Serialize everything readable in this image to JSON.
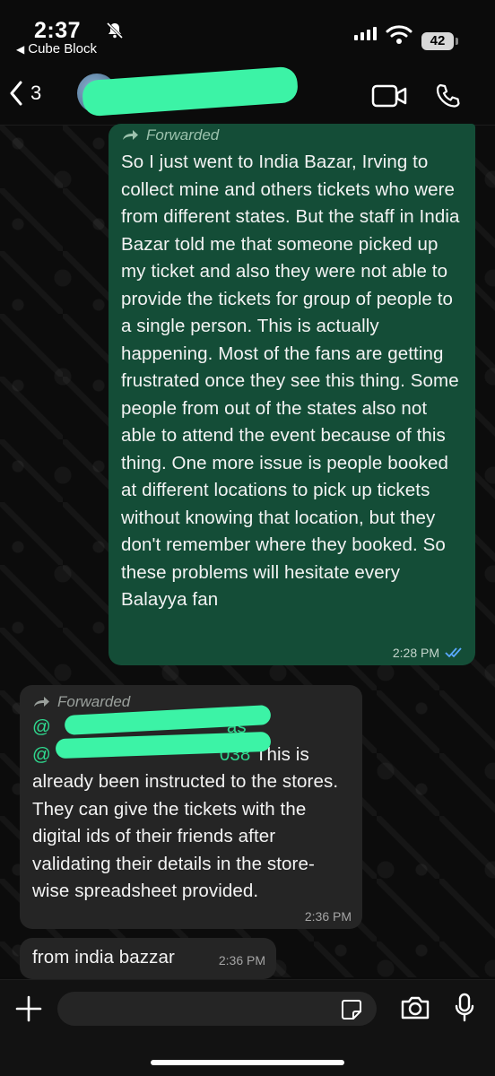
{
  "status_bar": {
    "time": "2:37",
    "carrier": "Cube Block",
    "battery": "42"
  },
  "header": {
    "back_count": "3",
    "contact_name": "",
    "icons": [
      "chevron-left-icon",
      "video-call-icon",
      "phone-icon"
    ]
  },
  "messages": [
    {
      "direction": "outgoing",
      "forwarded_label": "Forwarded",
      "text": "So I just went to India Bazar, Irving to collect mine and others tickets who were from different states. But the staff in India Bazar told me that someone picked up my ticket and also they were not able to provide the tickets for group of people to a single person. This is actually happening. Most of the fans are getting frustrated once they see this thing. Some people from out of the states also not able to attend the event because of this thing. One more issue is people booked at different locations to pick up tickets without knowing that location, but they don't remember where they booked. So these problems will hesitate every Balayya fan",
      "time": "2:28 PM",
      "status": "read"
    },
    {
      "direction": "incoming",
      "forwarded_label": "Forwarded",
      "mention_1": "@",
      "mention_2": "@",
      "mention_2_tail": "038",
      "mention_1_tail": "as",
      "text": " This is already been instructed to the stores. They can give the tickets with the digital ids of their friends after validating their details in the store-wise spreadsheet provided.",
      "time": "2:36 PM"
    },
    {
      "direction": "incoming",
      "text": "from india bazzar",
      "time": "2:36 PM"
    }
  ],
  "colors": {
    "outgoing_bubble": "#144d37",
    "incoming_bubble": "#252525",
    "mention": "#2fd98f",
    "read_ticks": "#5aa9ff"
  }
}
